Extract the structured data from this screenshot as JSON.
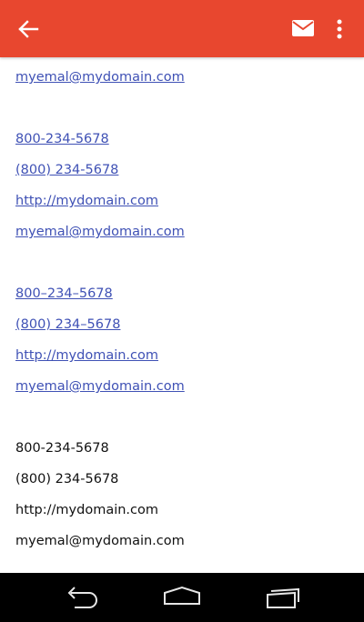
{
  "app_bar": {
    "color": "#e8472f",
    "back_icon": "arrow-left-icon",
    "mail_icon": "mail-icon",
    "more_icon": "more-vertical-icon"
  },
  "content": {
    "links_color": "#3f51b5",
    "top_email": "myemal@mydomain.com",
    "group1": {
      "phone1": "800-234-5678",
      "phone2": "(800) 234-5678",
      "url": "http://mydomain.com",
      "email": "myemal@mydomain.com"
    },
    "group2": {
      "phone1": "800–234–5678",
      "phone2": "(800) 234–5678",
      "url": "http://mydomain.com",
      "email": "myemal@mydomain.com"
    },
    "group3": {
      "phone1": "800-234-5678",
      "phone2": "(800) 234-5678",
      "url": "http://mydomain.com",
      "email": "myemal@mydomain.com"
    }
  },
  "nav_bar": {
    "back_icon": "nav-back-icon",
    "home_icon": "nav-home-icon",
    "recents_icon": "nav-recents-icon"
  }
}
